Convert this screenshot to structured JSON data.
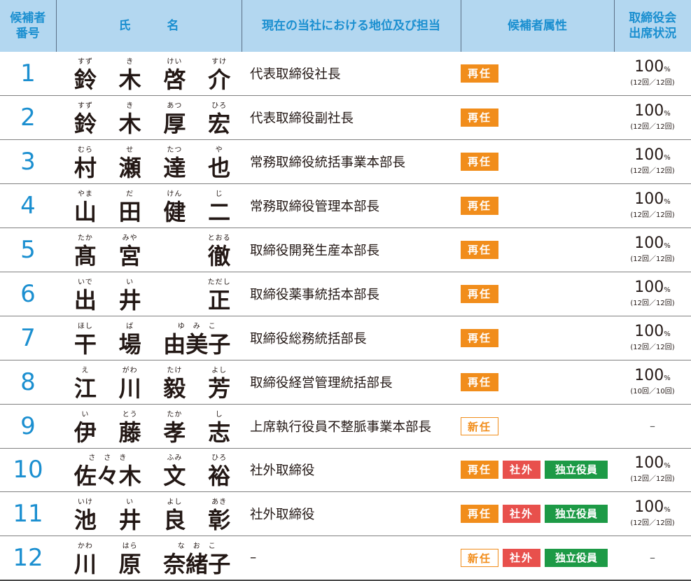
{
  "headers": {
    "no_l1": "候補者",
    "no_l2": "番号",
    "name_a": "氏",
    "name_b": "名",
    "position": "現在の当社における地位及び担当",
    "attribute": "候補者属性",
    "att_l1": "取締役会",
    "att_l2": "出席状況"
  },
  "badges": {
    "re": "再任",
    "new": "新任",
    "outside": "社外",
    "independent": "独立役員"
  },
  "colors": {
    "header_bg": "#b3d7f0",
    "accent_blue": "#1b8fd0",
    "reappoint": "#f18d1b",
    "outside": "#e8504c",
    "independent": "#1d9a46"
  },
  "rows": [
    {
      "no": "1",
      "name": [
        {
          "r": "すず",
          "k": "鈴"
        },
        {
          "r": "き",
          "k": "木"
        },
        {
          "r": "けい",
          "k": "啓"
        },
        {
          "r": "すけ",
          "k": "介"
        }
      ],
      "position": "代表取締役社長",
      "pct": "100",
      "unit": "%",
      "count": "(12回／12回)"
    },
    {
      "no": "2",
      "name": [
        {
          "r": "すず",
          "k": "鈴"
        },
        {
          "r": "き",
          "k": "木"
        },
        {
          "r": "あつ",
          "k": "厚"
        },
        {
          "r": "ひろ",
          "k": "宏"
        }
      ],
      "position": "代表取締役副社長",
      "pct": "100",
      "unit": "%",
      "count": "(12回／12回)"
    },
    {
      "no": "3",
      "name": [
        {
          "r": "むら",
          "k": "村"
        },
        {
          "r": "せ",
          "k": "瀬"
        },
        {
          "r": "たつ",
          "k": "達"
        },
        {
          "r": "や",
          "k": "也"
        }
      ],
      "position": "常務取締役統括事業本部長",
      "pct": "100",
      "unit": "%",
      "count": "(12回／12回)"
    },
    {
      "no": "4",
      "name": [
        {
          "r": "やま",
          "k": "山"
        },
        {
          "r": "だ",
          "k": "田"
        },
        {
          "r": "けん",
          "k": "健"
        },
        {
          "r": "じ",
          "k": "二"
        }
      ],
      "position": "常務取締役管理本部長",
      "pct": "100",
      "unit": "%",
      "count": "(12回／12回)"
    },
    {
      "no": "5",
      "name": [
        {
          "r": "たか",
          "k": "髙"
        },
        {
          "r": "みや",
          "k": "宮"
        },
        {
          "r": "",
          "k": ""
        },
        {
          "r": "とおる",
          "k": "徹"
        }
      ],
      "position": "取締役開発生産本部長",
      "pct": "100",
      "unit": "%",
      "count": "(12回／12回)"
    },
    {
      "no": "6",
      "name": [
        {
          "r": "いで",
          "k": "出"
        },
        {
          "r": "い",
          "k": "井"
        },
        {
          "r": "",
          "k": ""
        },
        {
          "r": "ただし",
          "k": "正"
        }
      ],
      "position": "取締役薬事統括本部長",
      "pct": "100",
      "unit": "%",
      "count": "(12回／12回)"
    },
    {
      "no": "7",
      "name": [
        {
          "r": "ほし",
          "k": "干"
        },
        {
          "r": "ば",
          "k": "場"
        },
        {
          "r": "ゆ　み　こ",
          "k": "由美子"
        },
        {
          "r": "",
          "k": ""
        }
      ],
      "position": "取締役総務統括部長",
      "pct": "100",
      "unit": "%",
      "count": "(12回／12回)"
    },
    {
      "no": "8",
      "name": [
        {
          "r": "え",
          "k": "江"
        },
        {
          "r": "がわ",
          "k": "川"
        },
        {
          "r": "たけ",
          "k": "毅"
        },
        {
          "r": "よし",
          "k": "芳"
        }
      ],
      "position": "取締役経営管理統括部長",
      "pct": "100",
      "unit": "%",
      "count": "(10回／10回)"
    },
    {
      "no": "9",
      "name": [
        {
          "r": "い",
          "k": "伊"
        },
        {
          "r": "とう",
          "k": "藤"
        },
        {
          "r": "たか",
          "k": "孝"
        },
        {
          "r": "し",
          "k": "志"
        }
      ],
      "position": "上席執行役員不整脈事業本部長",
      "pct": "–",
      "unit": "",
      "count": ""
    },
    {
      "no": "10",
      "name": [
        {
          "r": "さ　さ　き",
          "k": "佐々木"
        },
        {
          "r": "ふみ",
          "k": "文"
        },
        {
          "r": "ひろ",
          "k": "裕"
        }
      ],
      "position": "社外取締役",
      "pct": "100",
      "unit": "%",
      "count": "(12回／12回)"
    },
    {
      "no": "11",
      "name": [
        {
          "r": "いけ",
          "k": "池"
        },
        {
          "r": "い",
          "k": "井"
        },
        {
          "r": "よし",
          "k": "良"
        },
        {
          "r": "あき",
          "k": "彰"
        }
      ],
      "position": "社外取締役",
      "pct": "100",
      "unit": "%",
      "count": "(12回／12回)"
    },
    {
      "no": "12",
      "name": [
        {
          "r": "かわ",
          "k": "川"
        },
        {
          "r": "はら",
          "k": "原"
        },
        {
          "r": "な　お　こ",
          "k": "奈緒子"
        }
      ],
      "position": "–",
      "pct": "–",
      "unit": "",
      "count": ""
    }
  ]
}
